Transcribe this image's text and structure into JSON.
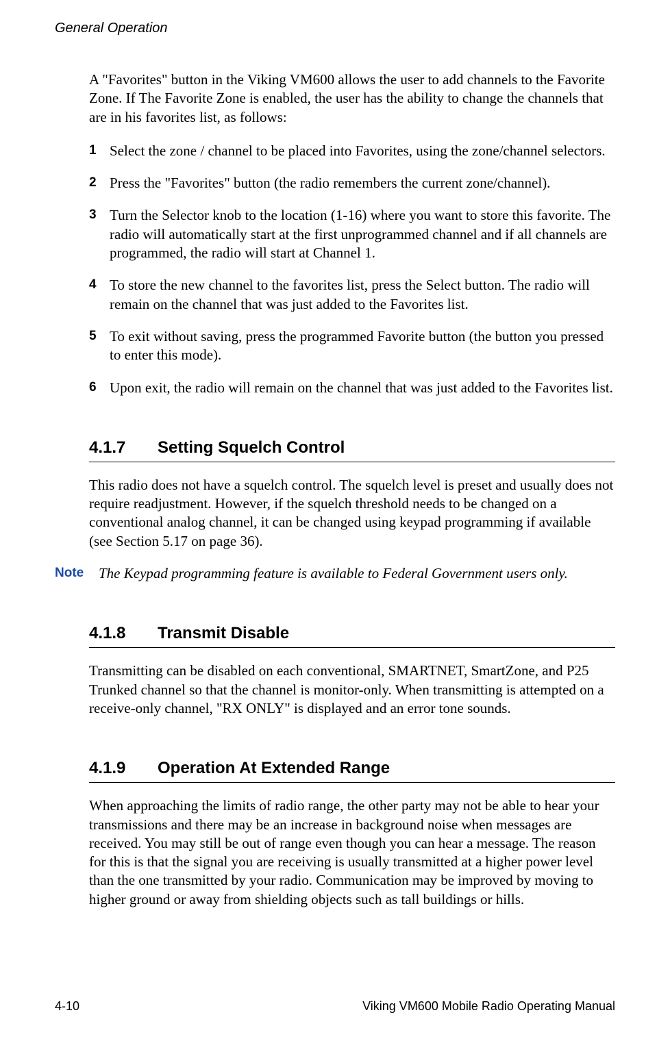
{
  "header": {
    "title": "General Operation"
  },
  "intro": "A \"Favorites\" button in the Viking VM600 allows the user to add channels to the Favorite Zone. If The Favorite Zone is enabled, the user has the ability to change the channels that are in his favorites list, as follows:",
  "steps": [
    {
      "num": "1",
      "text": "Select the zone / channel to be placed into Favorites, using the zone/channel selectors."
    },
    {
      "num": "2",
      "text": "Press the \"Favorites\" button (the radio remembers the current zone/channel)."
    },
    {
      "num": "3",
      "text": "Turn the Selector knob to the location (1-16) where you want to store this favorite. The radio will automatically start at the first unprogrammed channel and if all channels are programmed, the radio will start at Channel 1."
    },
    {
      "num": "4",
      "text": "To store the new channel to the favorites list, press the Select button. The radio will remain on the channel that was just added to the Favorites list."
    },
    {
      "num": "5",
      "text": "To exit without saving, press the programmed Favorite button (the button you pressed to enter this mode)."
    },
    {
      "num": "6",
      "text": "Upon exit, the radio will remain on the channel that was just added to the Favorites list."
    }
  ],
  "sections": {
    "s1": {
      "num": "4.1.7",
      "title": "Setting Squelch Control",
      "body": "This radio does not have a squelch control. The squelch level is preset and usually does not require readjustment. However, if the squelch threshold needs to be changed on a conventional analog channel, it can be changed using keypad programming if available (see Section 5.17 on page 36).",
      "note_label": "Note",
      "note_text": "The Keypad programming feature is available to Federal Government users only."
    },
    "s2": {
      "num": "4.1.8",
      "title": "Transmit Disable",
      "body": "Transmitting can be disabled on each conventional, SMARTNET, SmartZone, and P25 Trunked channel so that the channel is monitor-only. When transmitting is attempted on a receive-only channel, \"RX ONLY\" is displayed and an error tone sounds."
    },
    "s3": {
      "num": "4.1.9",
      "title": "Operation At Extended Range",
      "body": "When approaching the limits of radio range, the other party may not be able to hear your transmissions and there may be an increase in background noise when messages are received. You may still be out of range even though you can hear a message. The reason for this is that the signal you are receiving is usually transmitted at a higher power level than the one transmitted by your radio. Communication may be improved by moving to higher ground or away from shielding objects such as tall buildings or hills."
    }
  },
  "footer": {
    "page_num": "4-10",
    "doc_title": "Viking VM600 Mobile Radio Operating Manual"
  }
}
